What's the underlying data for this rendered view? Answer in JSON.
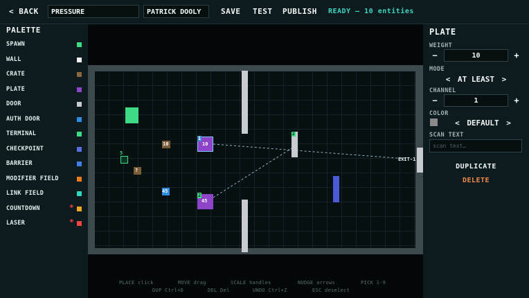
{
  "topbar": {
    "back_label": "< BACK",
    "level_name": "PRESSURE",
    "author": "PATRICK DOOLY",
    "save_label": "SAVE",
    "test_label": "TEST",
    "publish_label": "PUBLISH",
    "status": "READY — 10 entities"
  },
  "palette": {
    "title": "PALETTE",
    "items": [
      {
        "label": "SPAWN",
        "color": "#3ddc84"
      },
      {
        "label": "WALL",
        "color": "#f2f2f2"
      },
      {
        "label": "CRATE",
        "color": "#8a6a3c"
      },
      {
        "label": "PLATE",
        "color": "#8e44c9"
      },
      {
        "label": "DOOR",
        "color": "#c8ccd0"
      },
      {
        "label": "AUTH DOOR",
        "color": "#2f8de4"
      },
      {
        "label": "TERMINAL",
        "color": "#3ddc84"
      },
      {
        "label": "CHECKPOINT",
        "color": "#5a6ee0"
      },
      {
        "label": "BARRIER",
        "color": "#3f7fe8"
      },
      {
        "label": "MODIFIER FIELD",
        "color": "#f07a1a"
      },
      {
        "label": "LINK FIELD",
        "color": "#2fd9c0"
      },
      {
        "label": "COUNTDOWN",
        "color": "#f5a623",
        "star": "*"
      },
      {
        "label": "LASER",
        "color": "#f04545",
        "star": "*"
      }
    ]
  },
  "canvas": {
    "colors": {
      "spawn": "#3ddc84",
      "crate": "#7a5c36",
      "plate": "#8e44c9",
      "door": "#c8ccd0",
      "barrier": "#4a5ad8",
      "link": "#8fb4c8"
    },
    "entities": {
      "checkpoint_label": "5",
      "crate_a_label": "10",
      "crate_b_label": "?",
      "plate_a_channel": "1",
      "plate_a_weight": "10",
      "plate_b_channel": "2",
      "plate_b_weight": "45",
      "authdoor_label": "45",
      "door_channel": "2",
      "exit_label": "EXIT-1"
    },
    "hints_row1": [
      "PLACE click",
      "MOVE drag",
      "SCALE handles",
      "NUDGE arrows",
      "PICK 1-9"
    ],
    "hints_row2": [
      "DUP Ctrl+D",
      "DEL Del",
      "UNDO Ctrl+Z",
      "ESC deselect"
    ]
  },
  "inspector": {
    "title": "PLATE",
    "weight_label": "WEIGHT",
    "weight_value": "10",
    "minus": "−",
    "plus": "+",
    "mode_label": "MODE",
    "mode_value": "AT LEAST",
    "left_arrow": "<",
    "right_arrow": ">",
    "channel_label": "CHANNEL",
    "channel_value": "1",
    "color_label": "COLOR",
    "color_value": "DEFAULT",
    "color_swatch": "#8a8a8a",
    "scan_label": "SCAN TEXT",
    "scan_placeholder": "scan text…",
    "duplicate_label": "DUPLICATE",
    "delete_label": "DELETE",
    "delete_color": "#f08a4a"
  }
}
